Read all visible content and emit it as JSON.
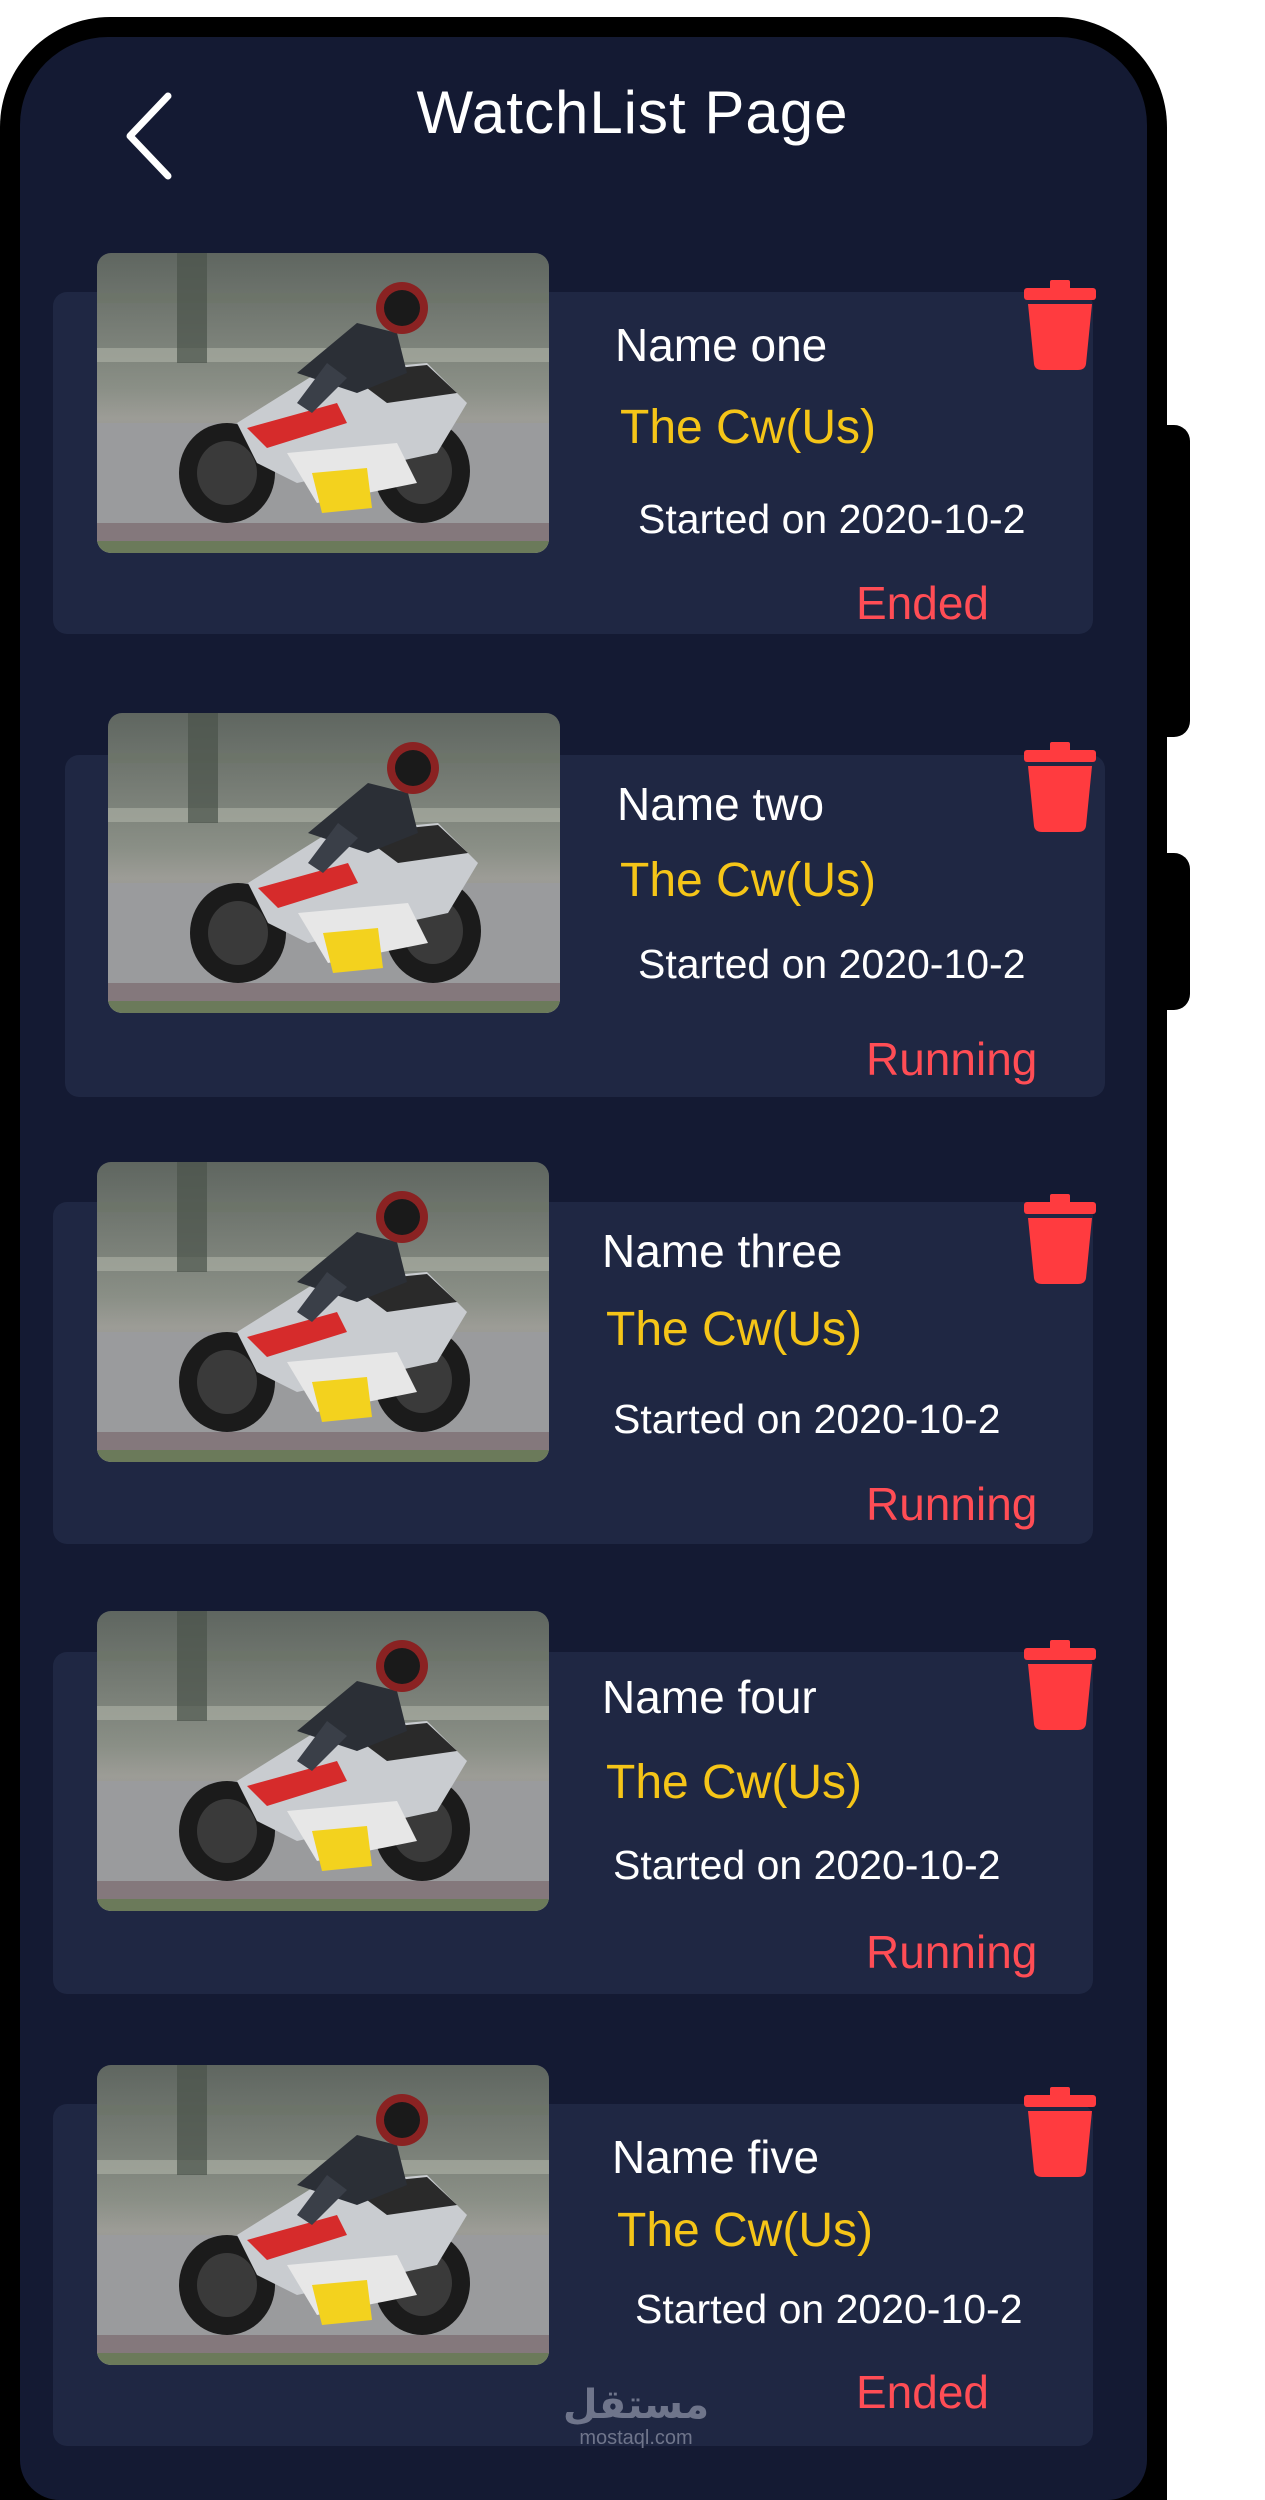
{
  "header": {
    "title": "WatchList Page"
  },
  "items": [
    {
      "name": "Name one",
      "channel": "The Cw(Us)",
      "started": "Started on 2020-10-2",
      "status": "Ended"
    },
    {
      "name": "Name two",
      "channel": "The Cw(Us)",
      "started": "Started on 2020-10-2",
      "status": "Running"
    },
    {
      "name": "Name three",
      "channel": "The Cw(Us)",
      "started": "Started on 2020-10-2",
      "status": "Running"
    },
    {
      "name": "Name four",
      "channel": "The Cw(Us)",
      "started": "Started on 2020-10-2",
      "status": "Running"
    },
    {
      "name": "Name five",
      "channel": "The Cw(Us)",
      "started": "Started on 2020-10-2",
      "status": "Ended"
    }
  ],
  "watermark": {
    "arabic": "مستقل",
    "url": "mostaql.com"
  },
  "colors": {
    "background": "#141a33",
    "card": "#1f2743",
    "channel": "#f5c518",
    "status": "#ff4d55",
    "trash": "#ff3b3f"
  },
  "icons": {
    "back": "chevron-left-icon",
    "delete": "trash-icon"
  }
}
